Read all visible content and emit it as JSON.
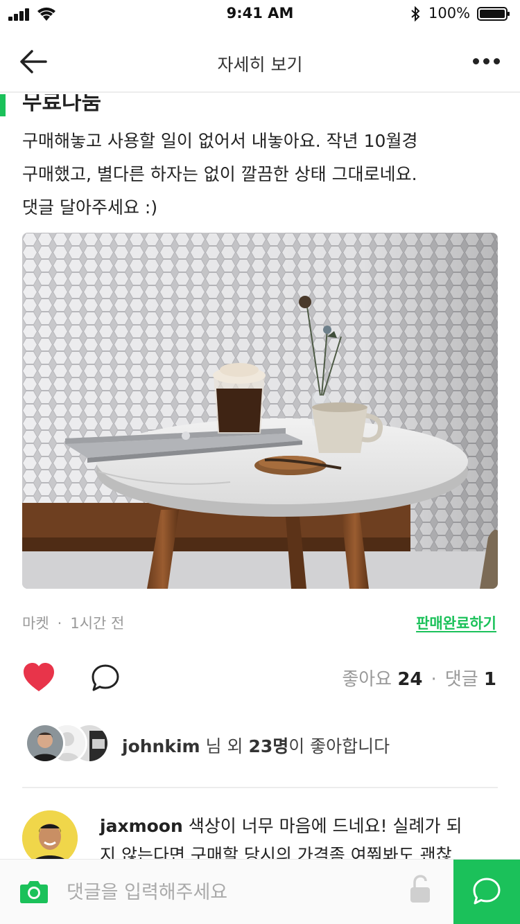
{
  "status_bar": {
    "time": "9:41 AM",
    "battery": "100%"
  },
  "nav": {
    "title": "자세히 보기"
  },
  "post": {
    "title": "무료나눔",
    "body_lines": [
      "구매해놓고 사용할 일이 없어서 내놓아요. 작년 10월경",
      "구매했고, 별다른 하자는 없이 깔끔한 상태 그대로네요.",
      "댓글 달아주세요 :)"
    ],
    "category": "마켓",
    "time_ago": "1시간 전",
    "mark_sold": "판매완료하기",
    "likes_label": "좋아요",
    "likes_count": "24",
    "comments_label": "댓글",
    "comments_count": "1",
    "liked_by_user": "johnkim",
    "liked_by_mid": " 님 외 ",
    "liked_by_others": "23명",
    "liked_by_suffix": "이 좋아합니다"
  },
  "comment": {
    "author": "jaxmoon",
    "text_line1": " 색상이 너무 마음에 드네요! 실례가 되",
    "text_line2": "지 않는다면 구매할 당시의 가격좀 여쭤봐도 괜찮"
  },
  "input": {
    "placeholder": "댓글을 입력해주세요"
  },
  "colors": {
    "accent": "#1bc15a",
    "heart": "#e8344a"
  }
}
